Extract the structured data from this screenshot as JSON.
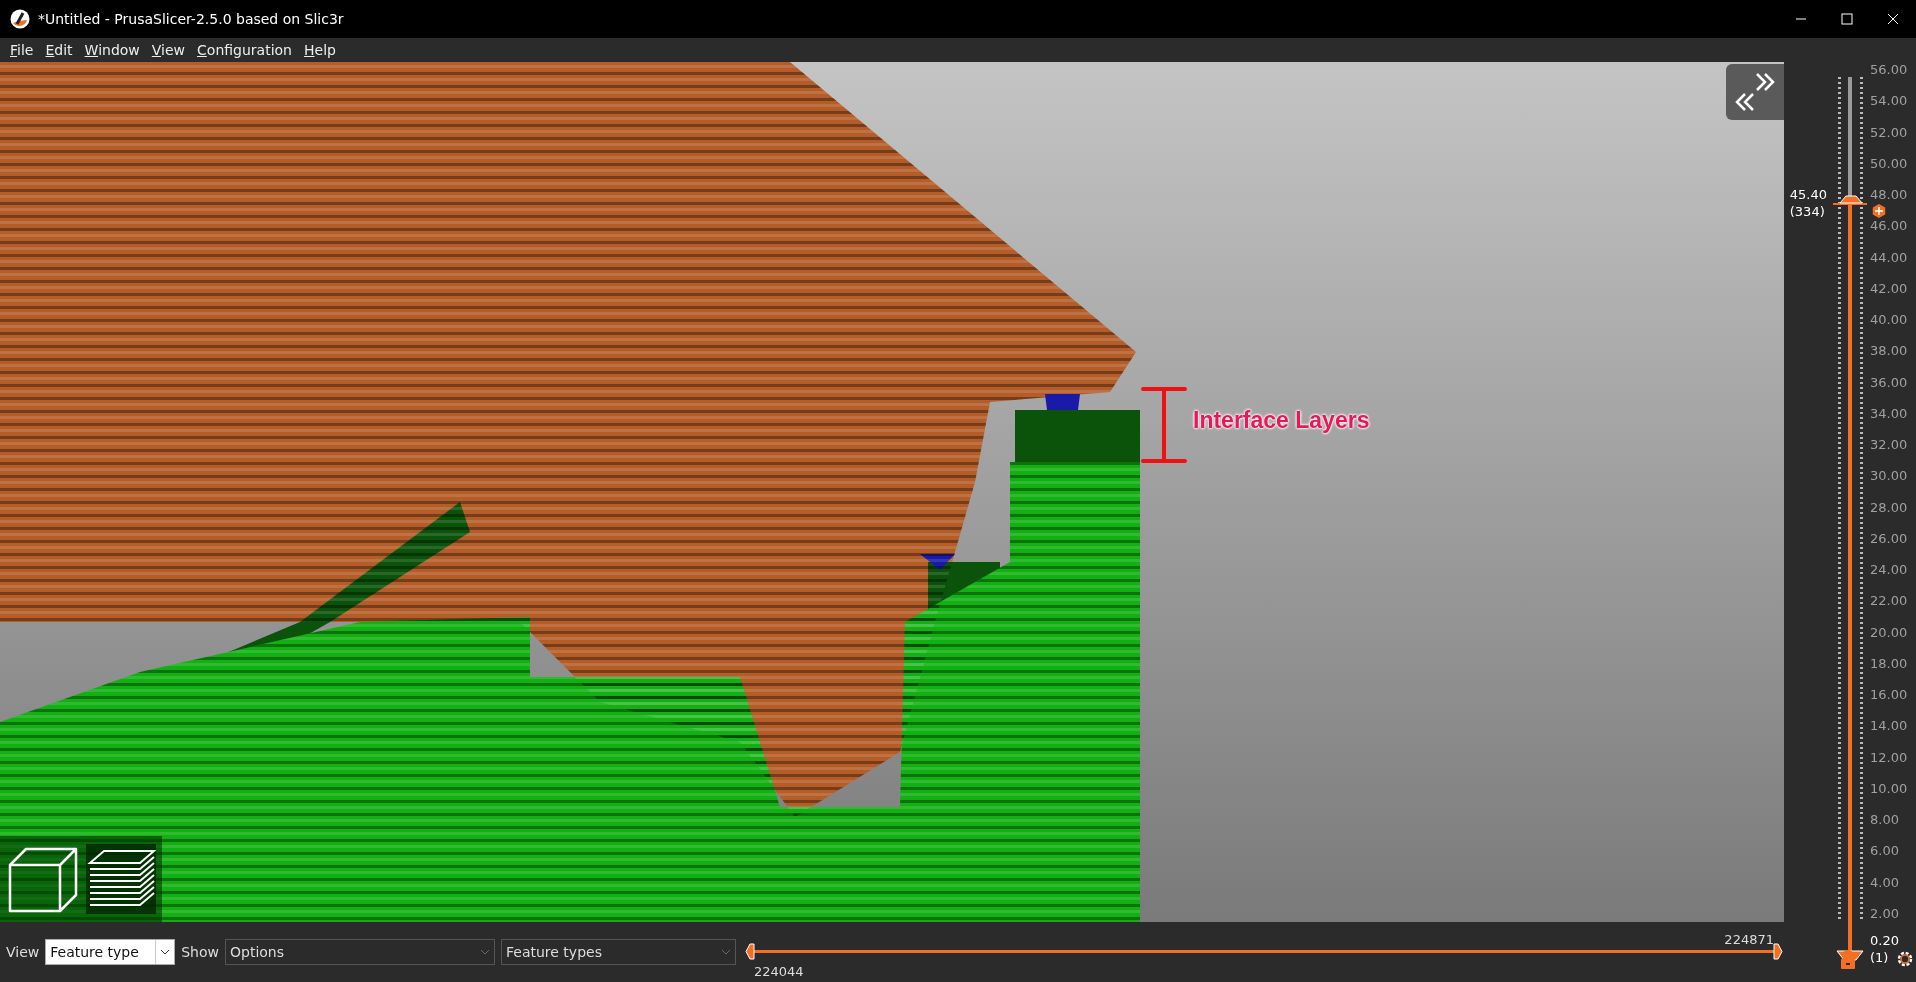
{
  "window": {
    "title": "*Untitled - PrusaSlicer-2.5.0 based on Slic3r"
  },
  "menu": [
    {
      "label": "File"
    },
    {
      "label": "Edit"
    },
    {
      "label": "Window"
    },
    {
      "label": "View"
    },
    {
      "label": "Configuration"
    },
    {
      "label": "Help"
    }
  ],
  "annotation": {
    "label": "Interface Layers"
  },
  "layer_slider": {
    "ticks": [
      "56.00",
      "54.00",
      "52.00",
      "50.00",
      "48.00",
      "46.00",
      "44.00",
      "42.00",
      "40.00",
      "38.00",
      "36.00",
      "34.00",
      "32.00",
      "30.00",
      "28.00",
      "26.00",
      "24.00",
      "22.00",
      "20.00",
      "18.00",
      "16.00",
      "14.00",
      "12.00",
      "10.00",
      "8.00",
      "6.00",
      "4.00",
      "2.00"
    ],
    "upper": {
      "value": "45.40",
      "layer": "(334)",
      "level": 0.856
    },
    "lower": {
      "value": "0.20",
      "layer": "(1)",
      "level": 0
    }
  },
  "bottom_bar": {
    "view_label": "View",
    "view_combo": {
      "value": "Feature type"
    },
    "show_label": "Show",
    "options_combo": {
      "value": "Options"
    },
    "feature_combo": {
      "value": "Feature types"
    }
  },
  "move_slider": {
    "start": {
      "label": "224044",
      "level": 0
    },
    "end": {
      "label": "224871",
      "level": 1
    }
  }
}
